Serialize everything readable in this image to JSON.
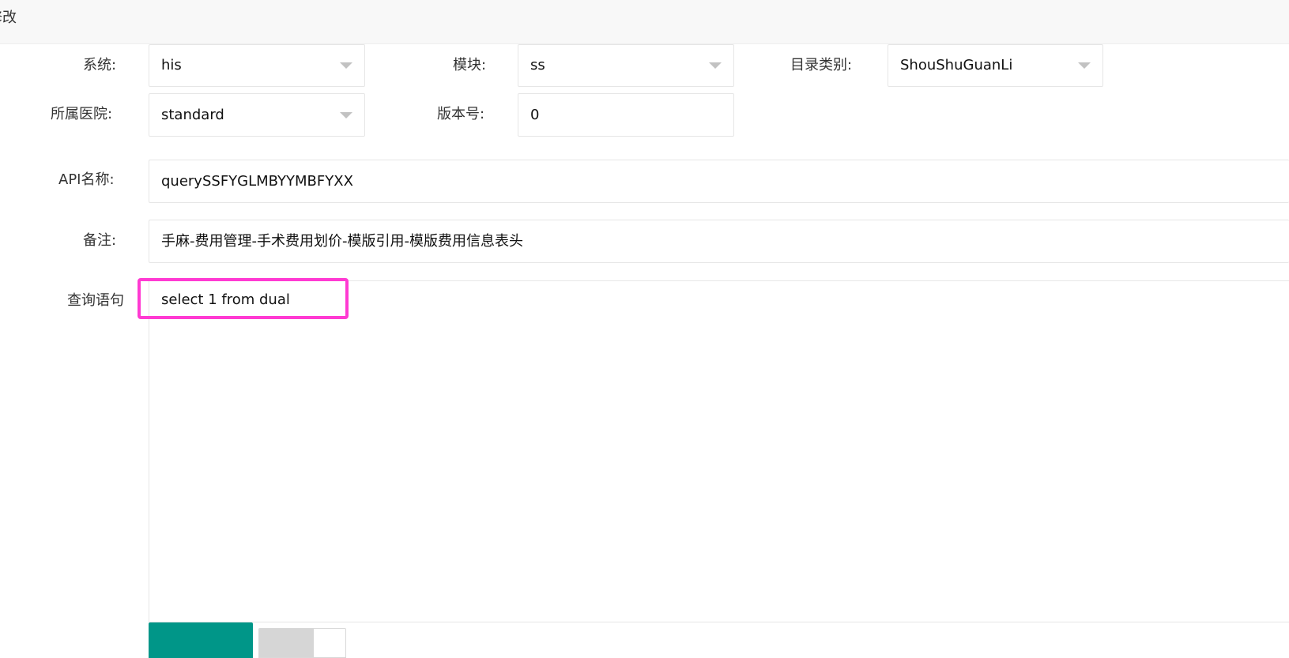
{
  "dialog": {
    "title": "修改"
  },
  "form": {
    "system": {
      "label": "系统:",
      "value": "his"
    },
    "module": {
      "label": "模块:",
      "value": "ss"
    },
    "directory_category": {
      "label": "目录类别:",
      "value": "ShouShuGuanLi"
    },
    "hospital": {
      "label": "所属医院:",
      "value": "standard"
    },
    "version": {
      "label": "版本号:",
      "value": "0"
    },
    "api_name": {
      "label": "API名称:",
      "value": "querySSFYGLMBYYMBFYXX"
    },
    "remark": {
      "label": "备注:",
      "value": "手麻-费用管理-手术费用划价-模版引用-模版费用信息表头"
    },
    "query_statement": {
      "label": "查询语句",
      "value": "select 1 from dual"
    }
  },
  "colors": {
    "highlight": "#ff3ad2",
    "primary_button": "#009688",
    "input_border": "#e6e6e6",
    "caret": "#c2c2c2"
  },
  "icons": {
    "select_caret": "chevron-down-icon"
  }
}
